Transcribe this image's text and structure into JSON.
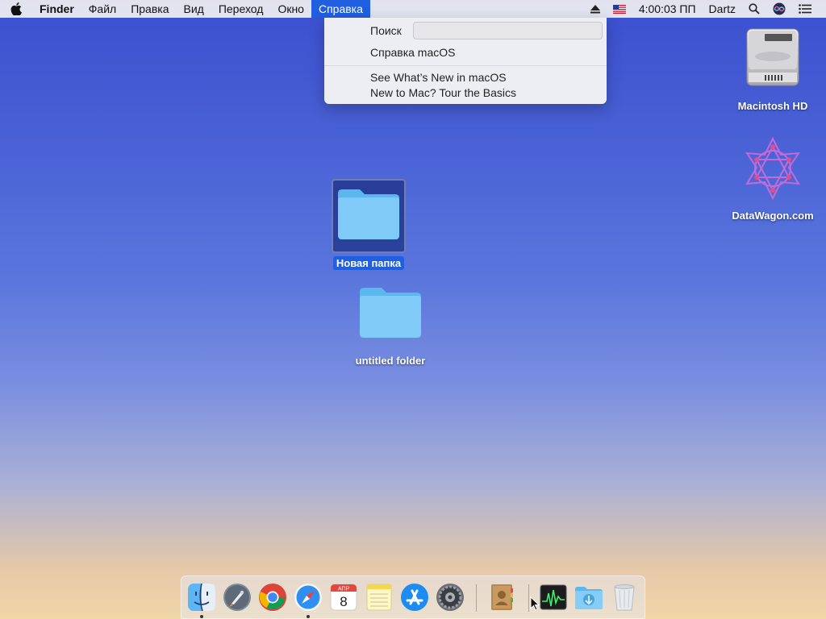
{
  "menubar": {
    "app_name": "Finder",
    "items": [
      "Файл",
      "Правка",
      "Вид",
      "Переход",
      "Окно"
    ],
    "active_item": "Справка",
    "clock": "4:00:03 ПП",
    "user": "Dartz"
  },
  "help_menu": {
    "search_label": "Поиск",
    "search_value": "",
    "item_macos_help": "Справка macOS",
    "item_whats_new": "See What’s New in macOS",
    "item_tour": "New to Mac? Tour the Basics"
  },
  "desktop": {
    "macintosh_hd": "Macintosh HD",
    "datawagon": "DataWagon.com",
    "new_folder": "Новая папка",
    "untitled_folder": "untitled folder"
  },
  "dock": {
    "calendar_month": "АПР",
    "calendar_day": "8"
  },
  "colors": {
    "accent": "#1f5fe0",
    "folder": "#74c5f5"
  }
}
